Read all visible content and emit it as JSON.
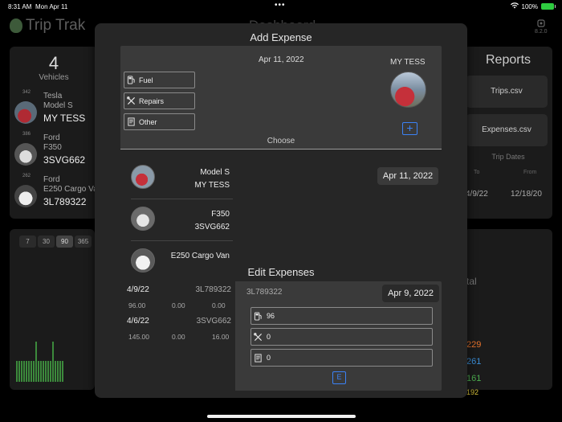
{
  "status_bar": {
    "time": "8:31 AM",
    "date": "Mon Apr 11",
    "battery": "100%"
  },
  "background": {
    "app_name": "Trip Trak",
    "version": "8.2.0",
    "header_title": "Dashboard",
    "vehicles": {
      "count": "4",
      "label": "Vehicles",
      "items": [
        {
          "num": "342",
          "make": "Tesla",
          "model": "Model S",
          "name": "MY TESS"
        },
        {
          "num": "386",
          "make": "Ford",
          "model": "F350",
          "name": "3SVG662"
        },
        {
          "num": "262",
          "make": "Ford",
          "model": "E250 Cargo Va",
          "name": "3L789322"
        }
      ]
    },
    "range_buttons": [
      "7",
      "30",
      "90",
      "365"
    ],
    "range_selected": "90",
    "reports": {
      "title": "Reports",
      "trips_csv": "Trips.csv",
      "expenses_csv": "Expenses.csv",
      "trip_dates": "Trip Dates",
      "to_label": "To",
      "from_label": "From",
      "to_date": "4/9/22",
      "from_date": "12/18/20"
    },
    "totals": {
      "label": "tal",
      "values": [
        "229",
        "261",
        "161",
        "192"
      ],
      "colors": [
        "#e8732c",
        "#3b8fd9",
        "#4caf50",
        "#d9c23b"
      ]
    }
  },
  "add_expense": {
    "title": "Add Expense",
    "date": "Apr 11, 2022",
    "types": [
      "Fuel",
      "Repairs",
      "Other"
    ],
    "selected_vehicle": "MY TESS",
    "add_button": "+",
    "choose_label": "Choose",
    "choose_items": [
      {
        "model": "Model S",
        "name": "MY TESS"
      },
      {
        "model": "F350",
        "name": "3SVG662"
      },
      {
        "model": "E250 Cargo Van",
        "name": ""
      }
    ],
    "date_button": "Apr 11, 2022"
  },
  "edit_expenses": {
    "title": "Edit Expenses",
    "rows": [
      {
        "date": "4/9/22",
        "plate": "3L789322",
        "fuel": "96.00",
        "repairs": "0.00",
        "other": "0.00"
      },
      {
        "date": "4/6/22",
        "plate": "3SVG662",
        "fuel": "145.00",
        "repairs": "0.00",
        "other": "16.00"
      }
    ],
    "selected_plate": "3L789322",
    "selected_date": "Apr 9, 2022",
    "fuel_value": "96",
    "repairs_value": "0",
    "other_value": "0",
    "edit_button": "E"
  }
}
